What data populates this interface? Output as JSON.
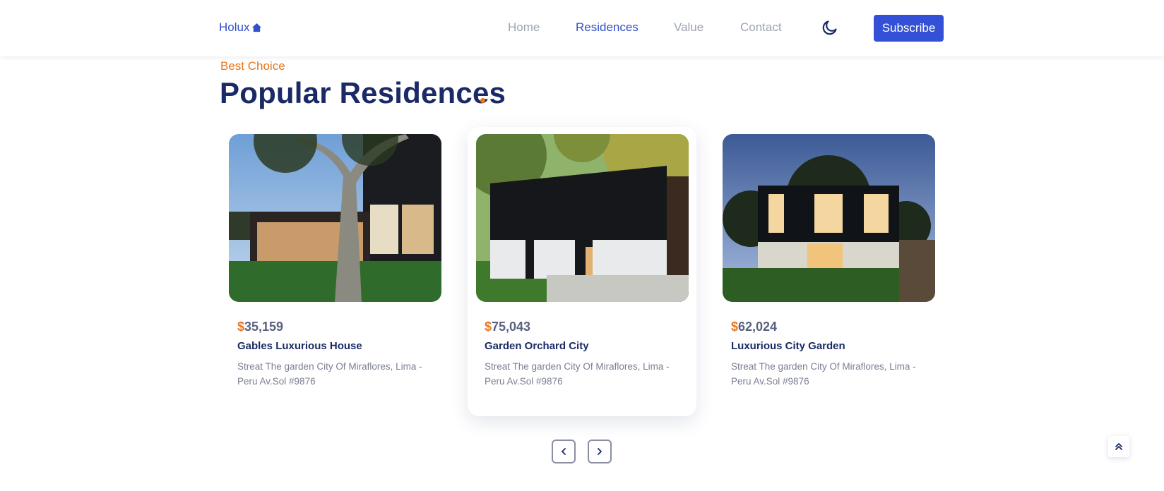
{
  "header": {
    "logo_text": "Holux",
    "logo_icon": "house-icon",
    "nav": [
      {
        "label": "Home",
        "active": false
      },
      {
        "label": "Residences",
        "active": true
      },
      {
        "label": "Value",
        "active": false
      },
      {
        "label": "Contact",
        "active": false
      }
    ],
    "theme_icon": "moon-icon",
    "subscribe_label": "Subscribe"
  },
  "section": {
    "subtitle": "Best Choice",
    "title": "Popular Residences"
  },
  "residences": [
    {
      "currency": "$",
      "price": "35,159",
      "name": "Gables Luxurious House",
      "address": "Streat The garden City Of Miraflores, Lima - Peru Av.Sol #9876",
      "featured": false
    },
    {
      "currency": "$",
      "price": "75,043",
      "name": "Garden Orchard City",
      "address": "Streat The garden City Of Miraflores, Lima - Peru Av.Sol #9876",
      "featured": true
    },
    {
      "currency": "$",
      "price": "62,024",
      "name": "Luxurious City Garden",
      "address": "Streat The garden City Of Miraflores, Lima - Peru Av.Sol #9876",
      "featured": false
    }
  ],
  "pagination": {
    "prev_icon": "chevron-left-icon",
    "next_icon": "chevron-right-icon"
  },
  "scroll_top_icon": "double-chevron-up-icon",
  "colors": {
    "primary": "#3350d6",
    "accent": "#e8761e",
    "title": "#1b2a66",
    "muted": "#9ea3b5"
  }
}
